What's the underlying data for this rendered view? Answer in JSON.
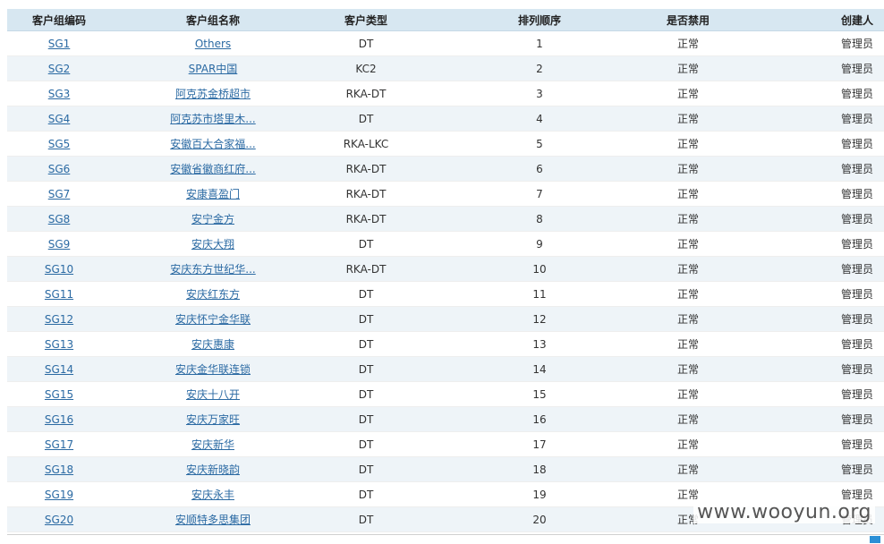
{
  "table": {
    "headers": {
      "code": "客户组编码",
      "name": "客户组名称",
      "type": "客户类型",
      "order": "排列顺序",
      "status": "是否禁用",
      "creator": "创建人"
    },
    "rows": [
      {
        "code": "SG1",
        "name": "Others",
        "type": "DT",
        "order": "1",
        "status": "正常",
        "creator": "管理员"
      },
      {
        "code": "SG2",
        "name": "SPAR中国",
        "type": "KC2",
        "order": "2",
        "status": "正常",
        "creator": "管理员"
      },
      {
        "code": "SG3",
        "name": "阿克苏金桥超市",
        "type": "RKA-DT",
        "order": "3",
        "status": "正常",
        "creator": "管理员"
      },
      {
        "code": "SG4",
        "name": "阿克苏市塔里木...",
        "type": "DT",
        "order": "4",
        "status": "正常",
        "creator": "管理员"
      },
      {
        "code": "SG5",
        "name": "安徽百大合家福...",
        "type": "RKA-LKC",
        "order": "5",
        "status": "正常",
        "creator": "管理员"
      },
      {
        "code": "SG6",
        "name": "安徽省徽商红府...",
        "type": "RKA-DT",
        "order": "6",
        "status": "正常",
        "creator": "管理员"
      },
      {
        "code": "SG7",
        "name": "安康喜盈门",
        "type": "RKA-DT",
        "order": "7",
        "status": "正常",
        "creator": "管理员"
      },
      {
        "code": "SG8",
        "name": "安宁金方",
        "type": "RKA-DT",
        "order": "8",
        "status": "正常",
        "creator": "管理员"
      },
      {
        "code": "SG9",
        "name": "安庆大翔",
        "type": "DT",
        "order": "9",
        "status": "正常",
        "creator": "管理员"
      },
      {
        "code": "SG10",
        "name": "安庆东方世纪华...",
        "type": "RKA-DT",
        "order": "10",
        "status": "正常",
        "creator": "管理员"
      },
      {
        "code": "SG11",
        "name": "安庆红东方",
        "type": "DT",
        "order": "11",
        "status": "正常",
        "creator": "管理员"
      },
      {
        "code": "SG12",
        "name": "安庆怀宁金华联",
        "type": "DT",
        "order": "12",
        "status": "正常",
        "creator": "管理员"
      },
      {
        "code": "SG13",
        "name": "安庆惠康",
        "type": "DT",
        "order": "13",
        "status": "正常",
        "creator": "管理员"
      },
      {
        "code": "SG14",
        "name": "安庆金华联连锁",
        "type": "DT",
        "order": "14",
        "status": "正常",
        "creator": "管理员"
      },
      {
        "code": "SG15",
        "name": "安庆十八开",
        "type": "DT",
        "order": "15",
        "status": "正常",
        "creator": "管理员"
      },
      {
        "code": "SG16",
        "name": "安庆万家旺",
        "type": "DT",
        "order": "16",
        "status": "正常",
        "creator": "管理员"
      },
      {
        "code": "SG17",
        "name": "安庆新华",
        "type": "DT",
        "order": "17",
        "status": "正常",
        "creator": "管理员"
      },
      {
        "code": "SG18",
        "name": "安庆新晓韵",
        "type": "DT",
        "order": "18",
        "status": "正常",
        "creator": "管理员"
      },
      {
        "code": "SG19",
        "name": "安庆永丰",
        "type": "DT",
        "order": "19",
        "status": "正常",
        "creator": "管理员"
      },
      {
        "code": "SG20",
        "name": "安顺特多思集团",
        "type": "DT",
        "order": "20",
        "status": "正常",
        "creator": "管理员"
      }
    ]
  },
  "watermark": "www.wooyun.org",
  "colors": {
    "header_bg": "#d7e7f1",
    "row_alt_bg": "#eef4f8",
    "link": "#2b6aa3"
  }
}
